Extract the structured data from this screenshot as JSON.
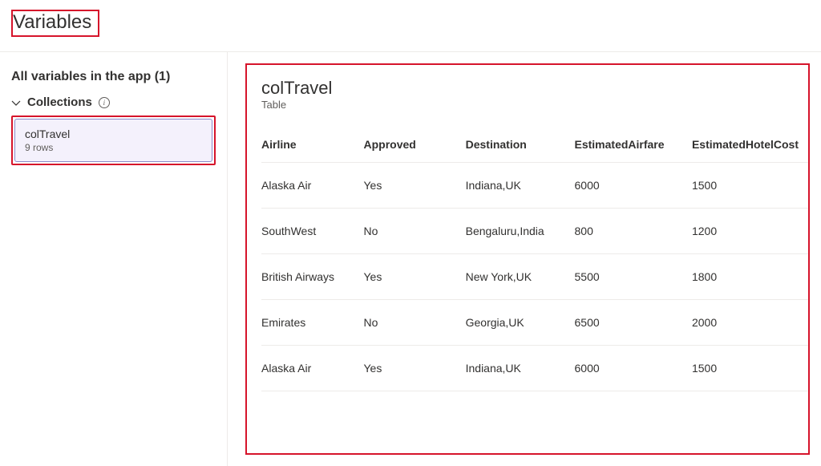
{
  "header": {
    "title": "Variables"
  },
  "sidebar": {
    "heading": "All variables in the app (1)",
    "collections_label": "Collections",
    "items": [
      {
        "name": "colTravel",
        "rows_label": "9 rows"
      }
    ]
  },
  "detail": {
    "title": "colTravel",
    "subtitle": "Table",
    "columns": [
      "Airline",
      "Approved",
      "Destination",
      "EstimatedAirfare",
      "EstimatedHotelCost"
    ],
    "rows": [
      {
        "Airline": "Alaska Air",
        "Approved": "Yes",
        "Destination": "Indiana,UK",
        "EstimatedAirfare": "6000",
        "EstimatedHotelCost": "1500"
      },
      {
        "Airline": "SouthWest",
        "Approved": "No",
        "Destination": "Bengaluru,India",
        "EstimatedAirfare": "800",
        "EstimatedHotelCost": "1200"
      },
      {
        "Airline": "British Airways",
        "Approved": "Yes",
        "Destination": "New York,UK",
        "EstimatedAirfare": "5500",
        "EstimatedHotelCost": "1800"
      },
      {
        "Airline": "Emirates",
        "Approved": "No",
        "Destination": "Georgia,UK",
        "EstimatedAirfare": "6500",
        "EstimatedHotelCost": "2000"
      },
      {
        "Airline": "Alaska Air",
        "Approved": "Yes",
        "Destination": "Indiana,UK",
        "EstimatedAirfare": "6000",
        "EstimatedHotelCost": "1500"
      }
    ]
  }
}
